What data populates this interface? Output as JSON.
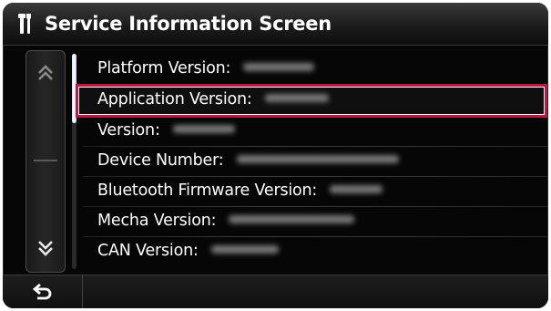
{
  "title_bar": {
    "icon": "tools-icon",
    "title": "Service Information Screen"
  },
  "scroll": {
    "up_icon": "double-chevron-up-icon",
    "down_icon": "double-chevron-down-icon",
    "position_fraction": 0.0
  },
  "rows": [
    {
      "label": "Platform Version:",
      "value_obscured": true
    },
    {
      "label": "Application Version:",
      "value_obscured": true,
      "highlighted": true
    },
    {
      "label": "Version:",
      "value_obscured": true
    },
    {
      "label": "Device Number:",
      "value_obscured": true
    },
    {
      "label": "Bluetooth Firmware Version:",
      "value_obscured": true
    },
    {
      "label": "Mecha Version:",
      "value_obscured": true
    },
    {
      "label": "CAN Version:",
      "value_obscured": true
    }
  ],
  "bottom_bar": {
    "back_icon": "back-arrow-icon"
  },
  "colors": {
    "highlight_border": "#c0153d",
    "background": "#060606",
    "text": "#ffffff"
  }
}
